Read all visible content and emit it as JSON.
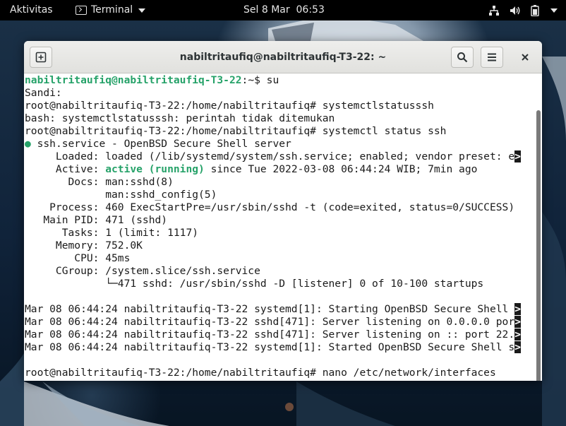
{
  "topbar": {
    "activities": "Aktivitas",
    "app_name": "Terminal",
    "clock": "Sel 8 Mar  06:53"
  },
  "window": {
    "title": "nabiltritaufiq@nabiltritaufiq-T3-22: ~"
  },
  "terminal": {
    "l1_user": "nabiltritaufiq@nabiltritaufiq-T3-22",
    "l1_rest": ":~$ su",
    "l2": "Sandi:",
    "l3": "root@nabiltritaufiq-T3-22:/home/nabiltritaufiq# systemctlstatusssh",
    "l4": "bash: systemctlstatusssh: perintah tidak ditemukan",
    "l5": "root@nabiltritaufiq-T3-22:/home/nabiltritaufiq# systemctl status ssh",
    "l6_dot": "●",
    "l6": " ssh.service - OpenBSD Secure Shell server",
    "l7": "     Loaded: loaded (/lib/systemd/system/ssh.service; enabled; vendor preset: e",
    "l8_pre": "     Active: ",
    "l8_active": "active (running)",
    "l8_post": " since Tue 2022-03-08 06:44:24 WIB; 7min ago",
    "l9": "       Docs: man:sshd(8)",
    "l10": "             man:sshd_config(5)",
    "l11": "    Process: 460 ExecStartPre=/usr/sbin/sshd -t (code=exited, status=0/SUCCESS)",
    "l12": "   Main PID: 471 (sshd)",
    "l13": "      Tasks: 1 (limit: 1117)",
    "l14": "     Memory: 752.0K",
    "l15": "        CPU: 45ms",
    "l16": "     CGroup: /system.slice/ssh.service",
    "l17": "             └─471 sshd: /usr/sbin/sshd -D [listener] 0 of 10-100 startups",
    "l18": "",
    "l19": "Mar 08 06:44:24 nabiltritaufiq-T3-22 systemd[1]: Starting OpenBSD Secure Shell ",
    "l20": "Mar 08 06:44:24 nabiltritaufiq-T3-22 sshd[471]: Server listening on 0.0.0.0 por",
    "l21": "Mar 08 06:44:24 nabiltritaufiq-T3-22 sshd[471]: Server listening on :: port 22.",
    "l22": "Mar 08 06:44:24 nabiltritaufiq-T3-22 systemd[1]: Started OpenBSD Secure Shell s",
    "l23": "",
    "l24": "root@nabiltritaufiq-T3-22:/home/nabiltritaufiq# nano /etc/network/interfaces",
    "trunc_marker": ">"
  },
  "icons": {
    "network": "network-icon",
    "volume": "volume-icon",
    "battery": "battery-icon",
    "power_menu": "chevron-down-icon",
    "new_tab": "new-tab-icon",
    "search": "search-icon",
    "menu": "hamburger-menu-icon",
    "close": "close-icon"
  },
  "colors": {
    "prompt_green": "#26a269",
    "topbar_bg": "#000000",
    "terminal_bg": "#ffffff"
  }
}
